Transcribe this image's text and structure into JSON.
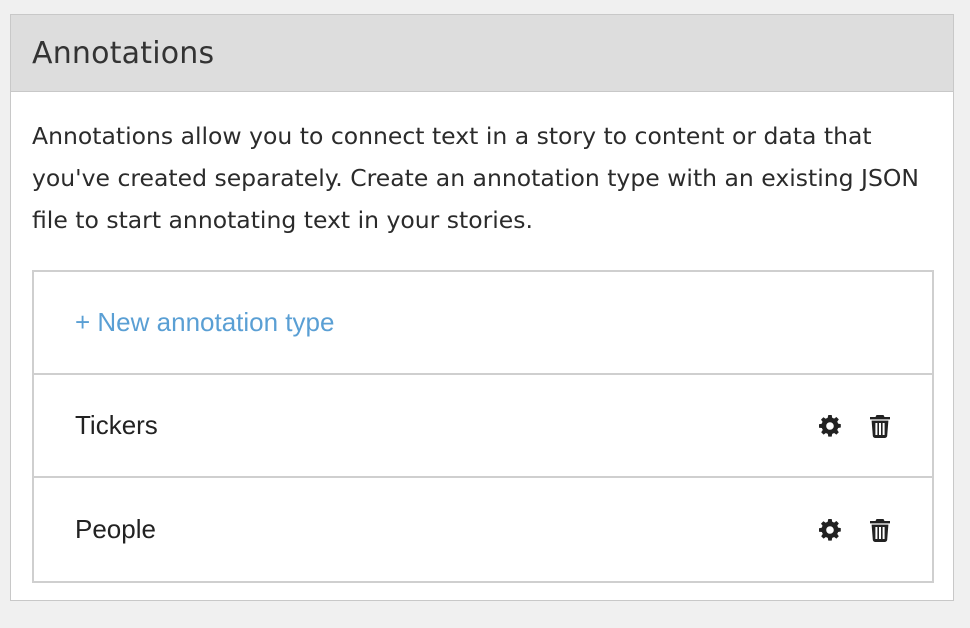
{
  "panel": {
    "title": "Annotations",
    "description": "Annotations allow you to connect text in a story to content or data that you've created separately. Create an annotation type with an existing JSON file to start annotating text in your stories."
  },
  "new_type_link": "+ New annotation type",
  "annotation_types": [
    {
      "name": "Tickers",
      "icons": [
        "gear-icon",
        "trash-icon"
      ]
    },
    {
      "name": "People",
      "icons": [
        "gear-icon",
        "trash-icon"
      ]
    }
  ],
  "colors": {
    "link": "#5a9fd4",
    "header_bg": "#dddddd",
    "border": "#cfcfcf"
  }
}
